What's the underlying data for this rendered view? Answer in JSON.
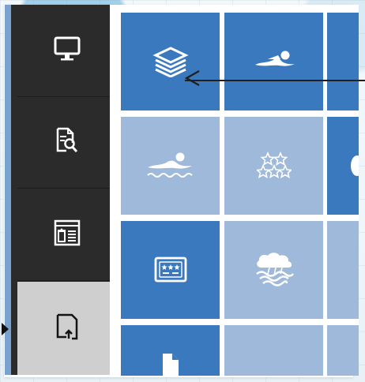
{
  "sidebar": {
    "items": [
      {
        "icon": "desktop-icon",
        "active": false
      },
      {
        "icon": "document-search-icon",
        "active": false
      },
      {
        "icon": "browser-window-icon",
        "active": false
      },
      {
        "icon": "page-upload-icon",
        "active": true
      }
    ]
  },
  "tiles": [
    {
      "icon": "layers-icon",
      "variant": "dark"
    },
    {
      "icon": "swimmer-icon",
      "variant": "dark"
    },
    {
      "icon": "swimmer-waves-icon",
      "variant": "light"
    },
    {
      "icon": "stars-icon",
      "variant": "light"
    },
    {
      "icon": "ticket-stars-icon",
      "variant": "dark"
    },
    {
      "icon": "cloud-water-icon",
      "variant": "light"
    },
    {
      "icon": "file-icon",
      "variant": "dark"
    }
  ],
  "colors": {
    "sidebar_bg": "#2b2b2b",
    "sidebar_active": "#cfcfcf",
    "tile_dark": "#3b79be",
    "tile_light": "#9eb9d9",
    "accent_left_border": "#7aa2cf"
  }
}
